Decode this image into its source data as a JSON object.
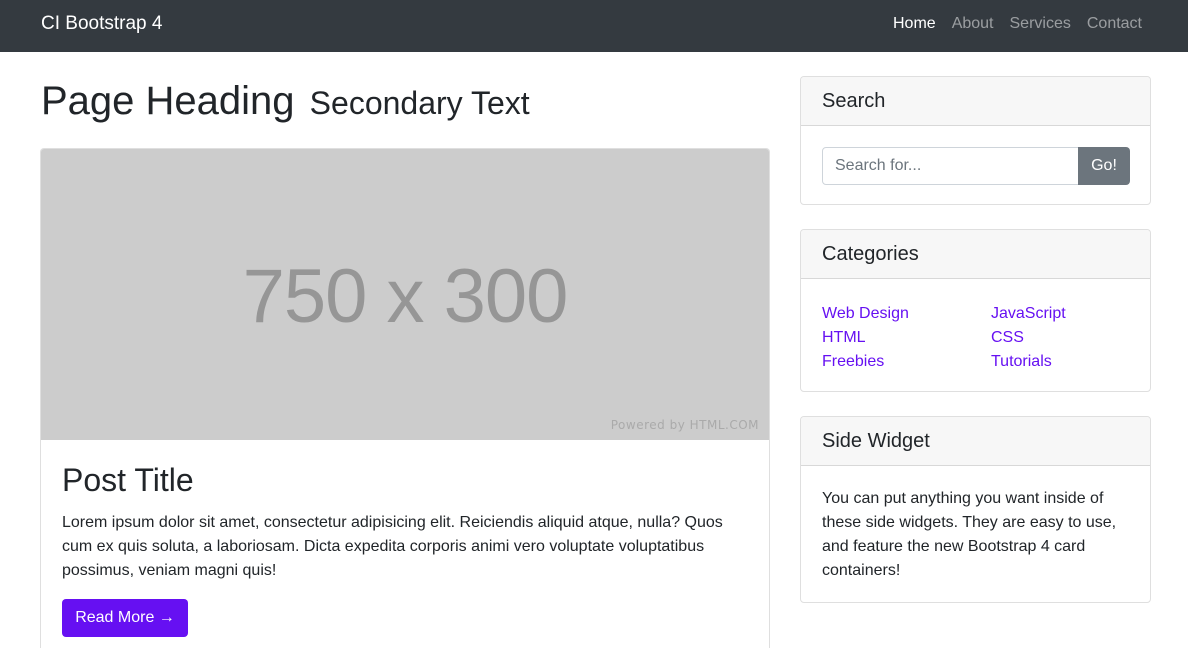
{
  "navbar": {
    "brand": "CI Bootstrap 4",
    "links": [
      {
        "label": "Home",
        "active": true
      },
      {
        "label": "About",
        "active": false
      },
      {
        "label": "Services",
        "active": false
      },
      {
        "label": "Contact",
        "active": false
      }
    ]
  },
  "heading": {
    "title": "Page Heading",
    "secondary": "Secondary Text"
  },
  "post": {
    "image_text": "750 x 300",
    "image_credit": "Powered by HTML.COM",
    "title": "Post Title",
    "text": "Lorem ipsum dolor sit amet, consectetur adipisicing elit. Reiciendis aliquid atque, nulla? Quos cum ex quis soluta, a laboriosam. Dicta expedita corporis animi vero voluptate voluptatibus possimus, veniam magni quis!",
    "button_label": "Read More →"
  },
  "search": {
    "title": "Search",
    "placeholder": "Search for...",
    "value": "",
    "button_label": "Go!"
  },
  "categories": {
    "title": "Categories",
    "left": [
      "Web Design",
      "HTML",
      "Freebies"
    ],
    "right": [
      "JavaScript",
      "CSS",
      "Tutorials"
    ]
  },
  "side_widget": {
    "title": "Side Widget",
    "text": "You can put anything you want inside of these side widgets. They are easy to use, and feature the new Bootstrap 4 card containers!"
  },
  "colors": {
    "navbar_bg": "#343a40",
    "accent": "#6610f2",
    "secondary_button": "#6c757d",
    "placeholder_bg": "#cccccc"
  }
}
